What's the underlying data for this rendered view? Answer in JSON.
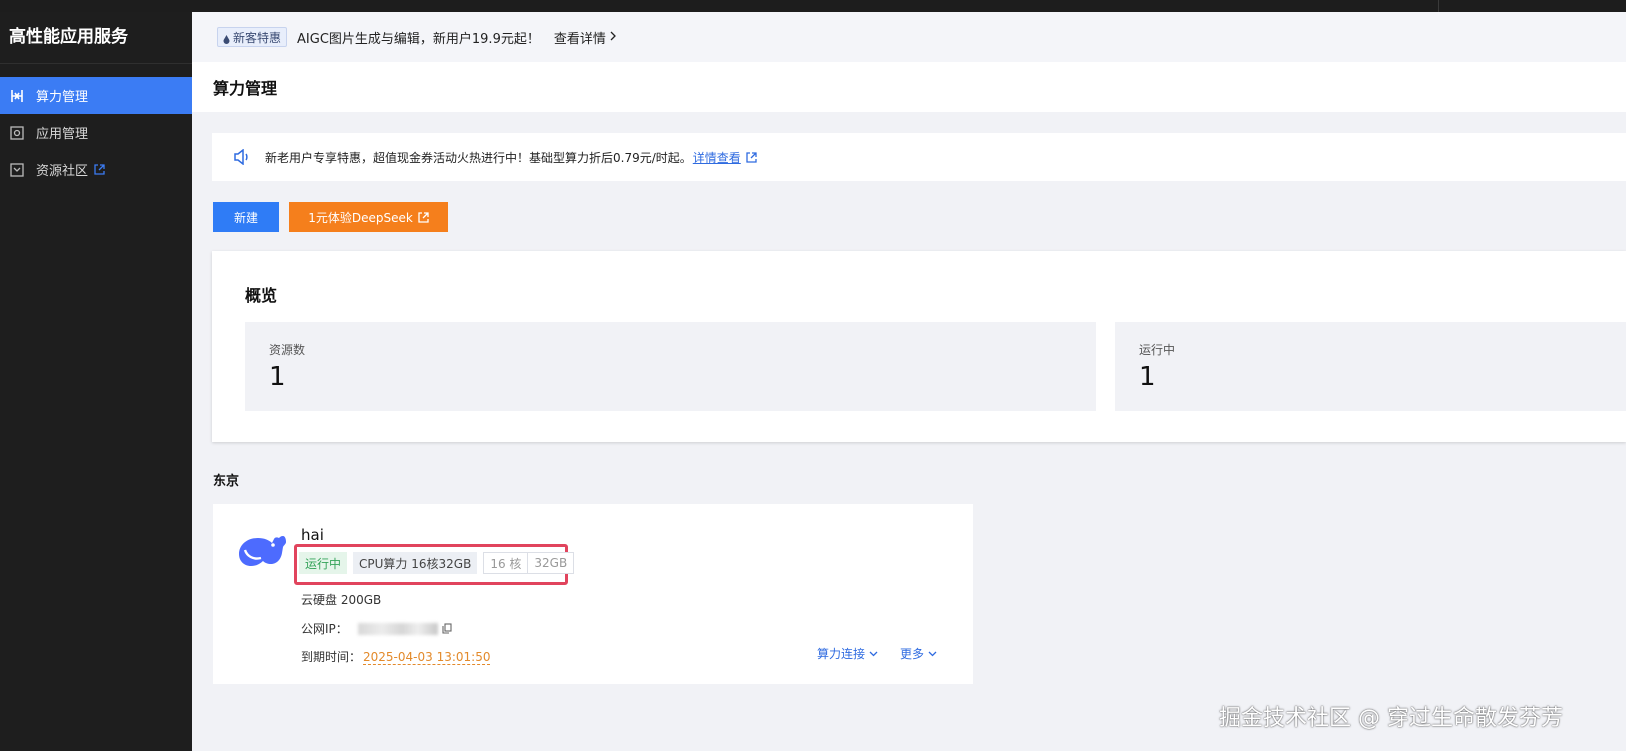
{
  "app": {
    "title": "高性能应用服务"
  },
  "sidebar": {
    "items": [
      {
        "label": "算力管理",
        "icon": "compute-icon",
        "active": true
      },
      {
        "label": "应用管理",
        "icon": "app-icon",
        "active": false
      },
      {
        "label": "资源社区",
        "icon": "community-icon",
        "active": false,
        "external": true
      }
    ]
  },
  "promo": {
    "badge": "新客特惠",
    "text": "AIGC图片生成与编辑，新用户19.9元起！",
    "link": "查看详情"
  },
  "page": {
    "title": "算力管理"
  },
  "notice": {
    "text": "新老用户专享特惠，超值现金券活动火热进行中！基础型算力折后0.79元/时起。",
    "link": "详情查看"
  },
  "buttons": {
    "new": "新建",
    "deepseek": "1元体验DeepSeek"
  },
  "overview": {
    "title": "概览",
    "stats": [
      {
        "label": "资源数",
        "value": "1"
      },
      {
        "label": "运行中",
        "value": "1"
      }
    ]
  },
  "region": "东京",
  "instance": {
    "name": "hai",
    "status": "运行中",
    "spec": "CPU算力 16核32GB",
    "cores": "16 核",
    "memory": "32GB",
    "disk": "云硬盘 200GB",
    "ip_label": "公网IP：",
    "expire_label": "到期时间：",
    "expire_value": "2025-04-03 13:01:50",
    "actions": {
      "connect": "算力连接",
      "more": "更多"
    }
  },
  "watermark": "掘金技术社区 @ 穿过生命散发芬芳",
  "colors": {
    "primary": "#2f7cf6",
    "accent_orange": "#f57f1c",
    "sidebar_bg": "#1e1e1e",
    "highlight_border": "#e1445d",
    "running_green": "#34a359"
  }
}
